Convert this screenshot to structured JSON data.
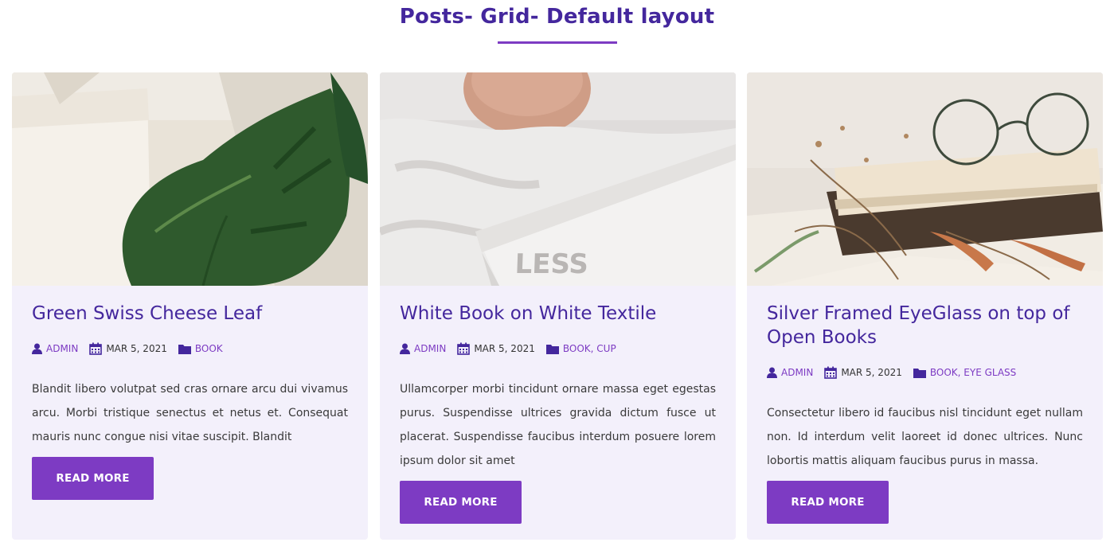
{
  "section": {
    "title": "Posts- Grid- Default layout"
  },
  "colors": {
    "accent": "#7d3bc3",
    "heading": "#44279d",
    "card_bg": "#f3f0fb"
  },
  "icons": {
    "author": "user-icon",
    "date": "calendar-icon",
    "category": "folder-icon"
  },
  "posts": [
    {
      "title": "Green Swiss Cheese Leaf",
      "author": "ADMIN",
      "date": "MAR 5, 2021",
      "categories": [
        "BOOK"
      ],
      "excerpt": "Blandit libero volutpat sed cras ornare arcu dui vivamus arcu. Morbi tristique senectus et netus et. Consequat mauris nunc congue nisi vitae suscipit. Blandit",
      "button": "READ MORE"
    },
    {
      "title": "White Book on White Textile",
      "author": "ADMIN",
      "date": "MAR 5, 2021",
      "categories": [
        "BOOK",
        "CUP"
      ],
      "excerpt": "Ullamcorper morbi tincidunt ornare massa eget egestas purus. Suspendisse ultrices gravida dictum fusce ut placerat. Suspendisse faucibus interdum posuere lorem ipsum dolor sit amet",
      "button": "READ MORE"
    },
    {
      "title": "Silver Framed EyeGlass on top of Open Books",
      "author": "ADMIN",
      "date": "MAR 5, 2021",
      "categories": [
        "BOOK",
        "EYE GLASS"
      ],
      "excerpt": "Consectetur libero id faucibus nisl tincidunt eget nullam non. Id interdum velit laoreet id donec ultrices. Nunc lobortis mattis aliquam faucibus purus in massa.",
      "button": "READ MORE"
    }
  ]
}
